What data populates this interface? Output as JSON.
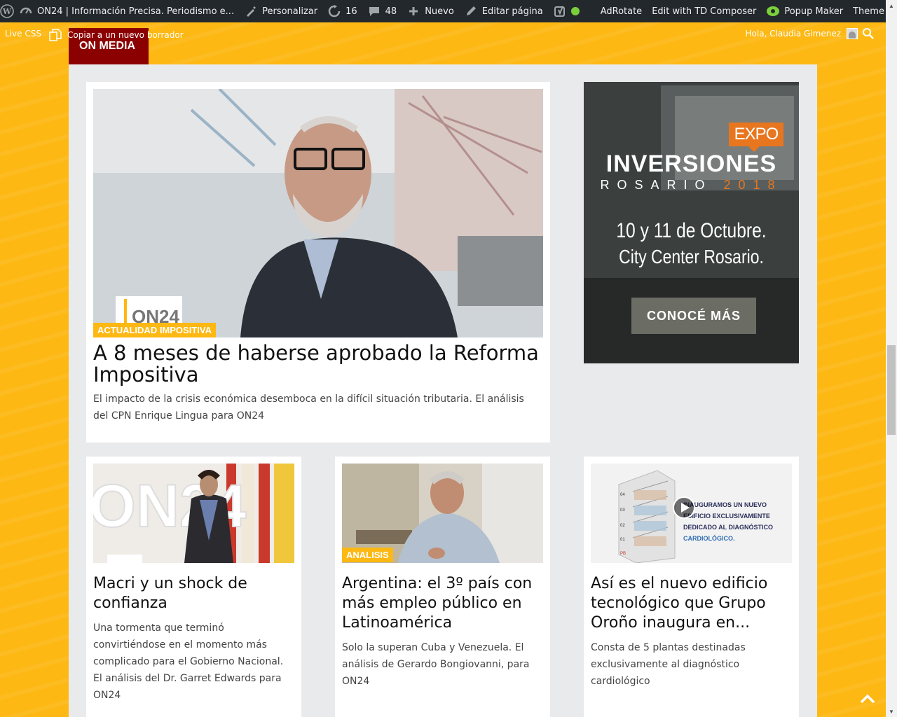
{
  "adminbar": {
    "site_name": "ON24 | Información Precisa. Periodismo e...",
    "customize": "Personalizar",
    "updates": "16",
    "comments": "48",
    "new": "Nuevo",
    "edit_page": "Editar página",
    "adrotate": "AdRotate",
    "td_composer": "Edit with TD Composer",
    "popup_maker": "Popup Maker",
    "theme_support": "Theme support"
  },
  "subbar": {
    "live_css": "Live CSS",
    "copy_draft": "Copiar a un nuevo borrador",
    "greeting": "Hola, Claudia Gimenez"
  },
  "section": {
    "title": "ON MEDIA"
  },
  "featured": {
    "category": "ACTUALIDAD IMPOSITIVA",
    "title": "A 8 meses de haberse aprobado la Reforma Impositiva",
    "excerpt": "El impacto de la crisis económica desemboca en la difícil situación tributaria. El análisis del CPN Enrique Lingua para ON24",
    "logo_text": "ON24"
  },
  "ad": {
    "badge": "EXPO",
    "headline": "INVERSIONES",
    "city": "ROSARIO",
    "year": "2018",
    "date": "10 y 11 de Octubre.",
    "venue": "City Center Rosario.",
    "cta": "CONOCÉ MÁS"
  },
  "cards": [
    {
      "title": "Macri y un shock de confianza",
      "excerpt": "Una tormenta que terminó convirtiéndose en el momento más complicado para el Gobierno Nacional. El análisis del Dr. Garret Edwards para ON24",
      "logo_text": "ON24"
    },
    {
      "category": "ANALISIS",
      "title": "Argentina: el 3º país con más empleo público en Latinoamérica",
      "excerpt": "Solo la superan Cuba y Venezuela. El análisis de Gerardo Bongiovanni, para ON24"
    },
    {
      "title": "Así es el nuevo edificio tecnológico que Grupo Oroño inaugura en...",
      "excerpt": "Consta de 5 plantas destinadas exclusivamente al diagnóstico cardiológico",
      "thumb_text_1": "INAUGURAMOS UN NUEVO",
      "thumb_text_2": "EDIFICIO EXCLUSIVAMENTE",
      "thumb_text_3": "DEDICADO AL DIAGNÓSTICO",
      "thumb_text_4": "CARDIOLÓGICO.",
      "floors": [
        "04",
        "03",
        "02",
        "01",
        "PB"
      ]
    }
  ],
  "colors": {
    "brand_yellow": "#FDB813",
    "section_red": "#8b0000",
    "ad_orange": "#e8761e"
  }
}
